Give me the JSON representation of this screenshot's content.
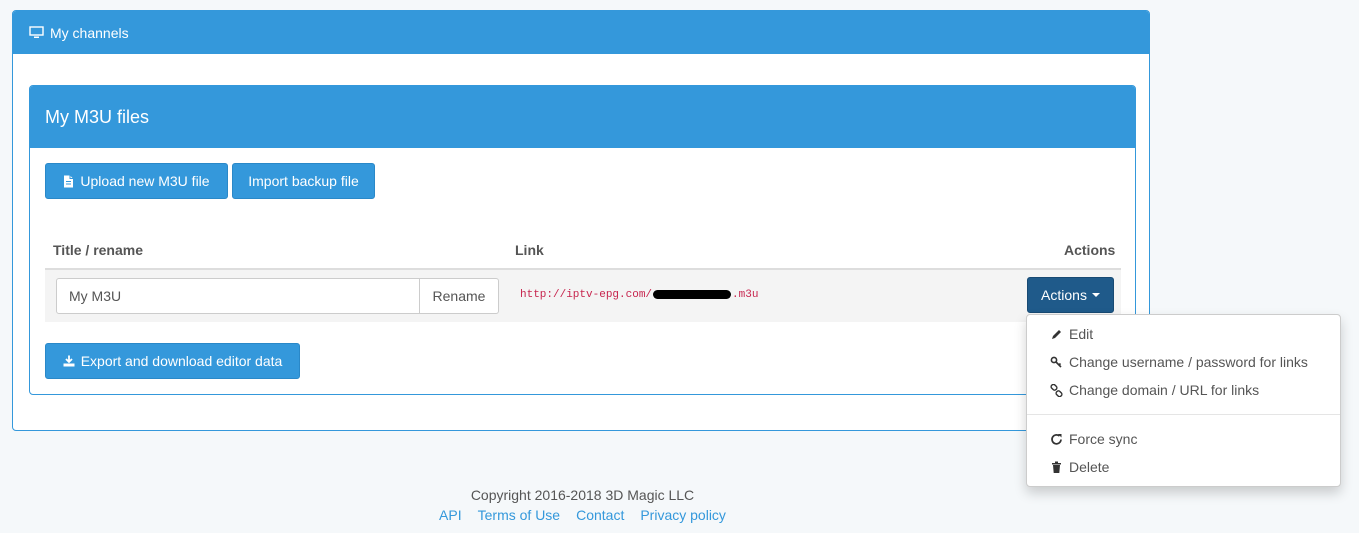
{
  "outer_panel": {
    "title": "My channels",
    "icon": "monitor-icon"
  },
  "inner_panel": {
    "title": "My M3U files"
  },
  "toolbar": {
    "upload_label": "Upload new M3U file",
    "import_label": "Import backup file",
    "export_label": "Export and download editor data"
  },
  "table": {
    "headers": {
      "title": "Title / rename",
      "link": "Link",
      "actions": "Actions"
    },
    "row": {
      "title_value": "My M3U",
      "rename_label": "Rename",
      "link_prefix": "http://iptv-epg.com/",
      "link_suffix": ".m3u",
      "actions_label": "Actions"
    }
  },
  "dropdown": {
    "items": [
      {
        "label": "Edit",
        "icon": "pencil-icon"
      },
      {
        "label": "Change username / password for links",
        "icon": "key-icon"
      },
      {
        "label": "Change domain / URL for links",
        "icon": "link-icon"
      },
      {
        "label": "Force sync",
        "icon": "refresh-icon"
      },
      {
        "label": "Delete",
        "icon": "trash-icon"
      }
    ]
  },
  "footer": {
    "copyright": "Copyright 2016-2018 3D Magic LLC",
    "links": [
      "API",
      "Terms of Use",
      "Contact",
      "Privacy policy"
    ]
  },
  "colors": {
    "primary": "#3498db",
    "actions_button": "#1f5a8a",
    "code": "#c7254e"
  }
}
